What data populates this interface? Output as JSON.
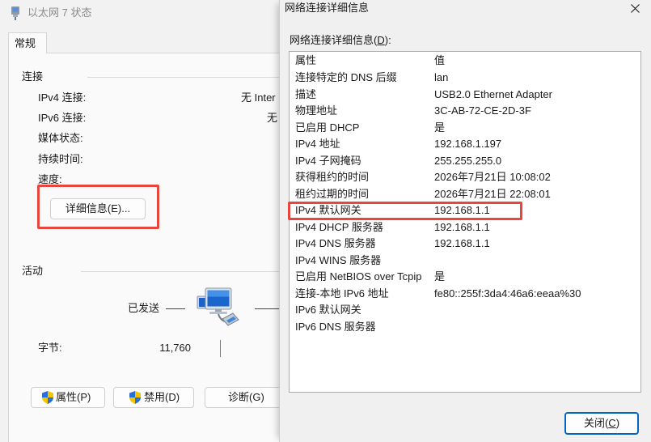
{
  "status_window": {
    "title": "以太网 7 状态",
    "icon": "ethernet-adapter-icon",
    "tab": "常规",
    "connection": {
      "heading": "连接",
      "rows": [
        {
          "label": "IPv4 连接:",
          "value": "无 Inter"
        },
        {
          "label": "IPv6 连接:",
          "value": "无"
        },
        {
          "label": "媒体状态:"
        },
        {
          "label": "持续时间:"
        },
        {
          "label": "速度:"
        }
      ],
      "details_button": {
        "label": "详细信息(E)...",
        "highlighted": true
      }
    },
    "activity": {
      "heading": "活动",
      "sent_label": "已发送",
      "icon": "network-connection-icon",
      "bytes_label": "字节:",
      "bytes_sent": "11,760"
    },
    "buttons": {
      "icon": "shield-icon",
      "properties": "属性(P)",
      "disable": "禁用(D)",
      "diagnose": "诊断(G)"
    }
  },
  "details_dialog": {
    "title": "网络连接详细信息",
    "close_icon": "close-icon",
    "list_label": {
      "before": "网络连接详细信息(",
      "key": "D",
      "after": "):"
    },
    "columns": [
      "属性",
      "值"
    ],
    "rows": [
      {
        "property": "连接特定的 DNS 后缀",
        "value": "lan"
      },
      {
        "property": "描述",
        "value": "USB2.0 Ethernet Adapter"
      },
      {
        "property": "物理地址",
        "value": "3C-AB-72-CE-2D-3F"
      },
      {
        "property": "已启用 DHCP",
        "value": "是"
      },
      {
        "property": "IPv4 地址",
        "value": "192.168.1.197"
      },
      {
        "property": "IPv4 子网掩码",
        "value": "255.255.255.0"
      },
      {
        "property": "获得租约的时间",
        "value": "2026年7月21日 10:08:02"
      },
      {
        "property": "租约过期的时间",
        "value": "2026年7月21日 22:08:01"
      },
      {
        "property": "IPv4 默认网关",
        "value": "192.168.1.1",
        "highlighted": true
      },
      {
        "property": "IPv4 DHCP 服务器",
        "value": "192.168.1.1"
      },
      {
        "property": "IPv4 DNS 服务器",
        "value": "192.168.1.1"
      },
      {
        "property": "IPv4 WINS 服务器"
      },
      {
        "property": "已启用 NetBIOS over Tcpip",
        "value": "是"
      },
      {
        "property": "连接-本地 IPv6 地址",
        "value": "fe80::255f:3da4:46a6:eeaa%30"
      },
      {
        "property": "IPv6 默认网关"
      },
      {
        "property": "IPv6 DNS 服务器"
      }
    ],
    "close_button": {
      "before": "关闭(",
      "key": "C",
      "after": ")"
    }
  },
  "colors": {
    "annotation_red": "#e8453c",
    "accent": "#0067c0",
    "shield_blue": "#2a6fd6",
    "shield_yellow": "#f5c400"
  }
}
